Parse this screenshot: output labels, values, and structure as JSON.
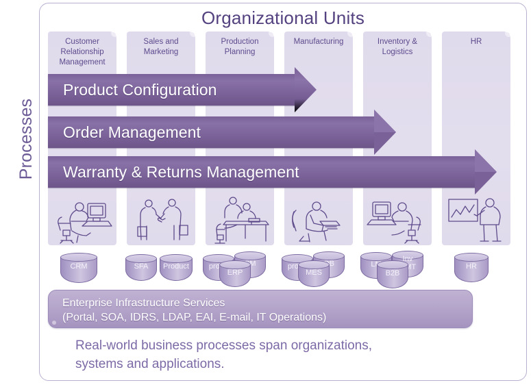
{
  "title": "Organizational Units",
  "axis_label": "Processes",
  "colors": {
    "title": "#54417f",
    "arrow": "#7a6298",
    "column_band": "#e0dbec",
    "infra_bar": "#b7a8cd",
    "caption": "#7c6aa6",
    "cylinder_stroke": "#7b6aa0",
    "frame_border": "#b9afd0"
  },
  "columns": [
    {
      "id": "crm",
      "label": "Customer\nRelationship\nManagement",
      "lines": [
        "Customer",
        "Relationship",
        "Management"
      ],
      "icon": "person-at-desktop-icon"
    },
    {
      "id": "sales",
      "label": "Sales and\nMarketing",
      "lines": [
        "Sales and",
        "Marketing"
      ],
      "icon": "handshake-icon"
    },
    {
      "id": "production",
      "label": "Production\nPlanning",
      "lines": [
        "Production",
        "Planning"
      ],
      "icon": "two-people-at-desk-icon"
    },
    {
      "id": "manufacturing",
      "label": "Manufacturing",
      "lines": [
        "Manufacturing"
      ],
      "icon": "person-reading-document-icon"
    },
    {
      "id": "inventory",
      "label": "Inventory &\nLogistics",
      "lines": [
        "Inventory &",
        "Logistics"
      ],
      "icon": "person-at-computer-icon"
    },
    {
      "id": "hr",
      "label": "HR",
      "lines": [
        "HR"
      ],
      "icon": "person-presenting-chart-icon"
    }
  ],
  "processes": [
    {
      "id": "product-configuration",
      "label": "Product Configuration",
      "spans_columns": 4
    },
    {
      "id": "order-management",
      "label": "Order Management",
      "spans_columns": 5
    },
    {
      "id": "warranty-returns-management",
      "label": "Warranty & Returns Management",
      "spans_columns": 6
    }
  ],
  "systems": [
    {
      "column": "crm",
      "items": [
        {
          "label": "CRM"
        }
      ]
    },
    {
      "column": "sales",
      "items": [
        {
          "label": "SFA"
        },
        {
          "label": "Product"
        }
      ]
    },
    {
      "column": "production",
      "items": [
        {
          "label": "produ"
        },
        {
          "label": "CM"
        },
        {
          "label": "ERP"
        }
      ]
    },
    {
      "column": "manufacturing",
      "items": [
        {
          "label": "produ"
        },
        {
          "label": "OB"
        },
        {
          "label": "MES"
        }
      ]
    },
    {
      "column": "inventory",
      "items": [
        {
          "label": "LM"
        },
        {
          "label": "Inv\nGMT"
        },
        {
          "label": "B2B"
        }
      ]
    },
    {
      "column": "hr",
      "items": [
        {
          "label": "HR"
        }
      ]
    }
  ],
  "infrastructure": {
    "line1": "Enterprise Infrastructure Services",
    "line2": "(Portal, SOA, IDRS, LDAP, EAI, E-mail, IT Operations)"
  },
  "caption": {
    "line1": "Real-world business processes span organizations,",
    "line2": "systems and applications."
  }
}
